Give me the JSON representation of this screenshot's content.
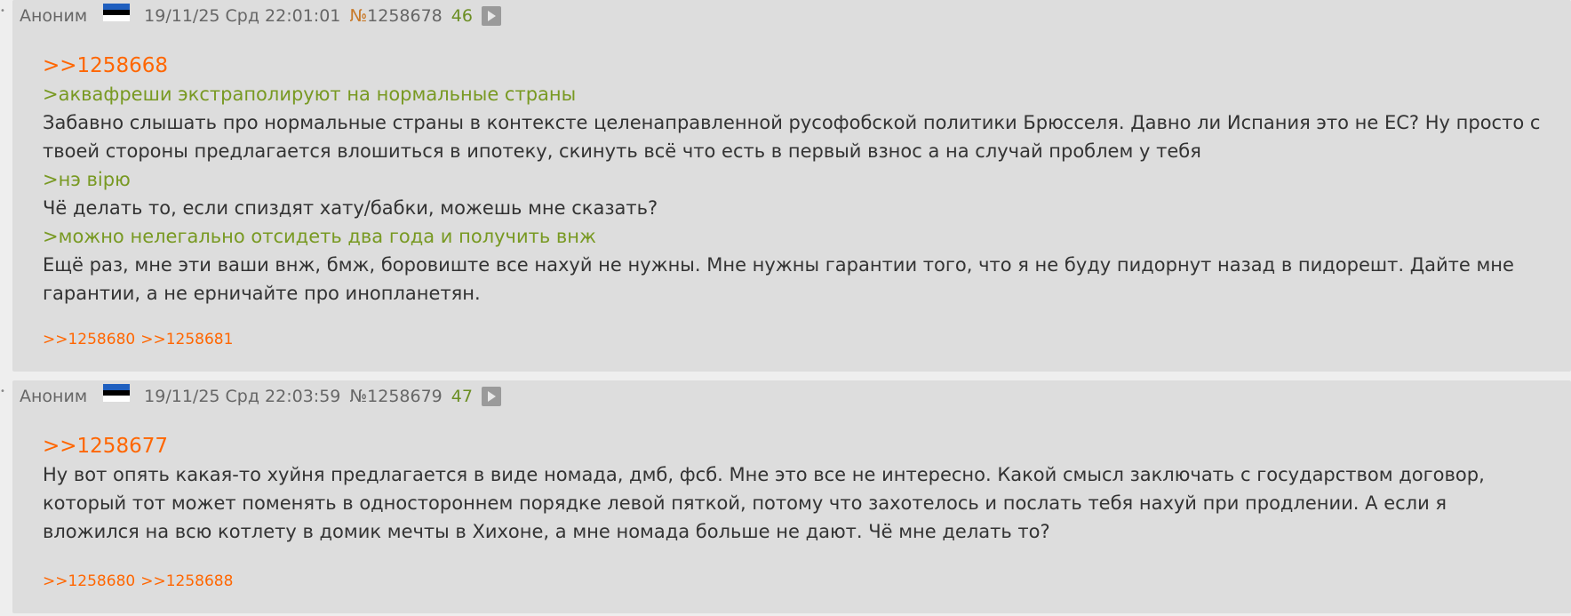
{
  "colors": {
    "page_bg": "#eeeeee",
    "post_bg": "#dddddd",
    "link": "#ff6600",
    "greentext": "#789922",
    "reply_count": "#6b8e23"
  },
  "posts": [
    {
      "marker": "•",
      "author": "Аноним",
      "flag_icon": "estonia-flag-icon",
      "date": "19/11/25 Срд 22:01:01",
      "num_sign": "№",
      "num": "1258678",
      "reply_count": "46",
      "body": {
        "reply_to": ">>1258668",
        "lines": [
          {
            "type": "quote",
            "text": ">аквафреши экстраполируют на нормальные страны"
          },
          {
            "type": "text",
            "text": "Забавно слышать про нормальные страны в контексте целенаправленной русофобской политики Брюсселя. Давно ли Испания это не ЕС? Ну просто с твоей стороны предлагается вл­ошиться в ипотеку, скинуть всё что есть в первый взнос а на случай проблем у тебя"
          },
          {
            "type": "quote",
            "text": ">нэ вiрю"
          },
          {
            "type": "text",
            "text": "Чё делать то, если спиздят хату/бабки, можешь мне сказать?"
          },
          {
            "type": "quote",
            "text": ">можно нелегально отсидеть два года и получить внж"
          },
          {
            "type": "text",
            "text": "Ещё раз, мне эти ваши внж, бмж, боровиште все нахуй не нужны. Мне нужны гарантии того, что я не буду пидорнут назад в пидорешт. Дайте мне гарантии, а не ерничайте про инопланетян."
          }
        ]
      },
      "backlinks": [
        ">>1258680",
        ">>1258681"
      ]
    },
    {
      "marker": "•",
      "author": "Аноним",
      "flag_icon": "estonia-flag-icon",
      "date": "19/11/25 Срд 22:03:59",
      "num_sign": "№",
      "num": "1258679",
      "reply_count": "47",
      "body": {
        "reply_to": ">>1258677",
        "lines": [
          {
            "type": "text",
            "text": "Ну вот опять какая-то хуйня предлагается в виде номада, дмб, фсб. Мне это все не интересно. Какой смысл заключать с государством договор, который тот может поменять в одностороннем порядке левой пяткой, потому что захотелось и послать тебя нахуй при продлении. А если я вложился на всю котлету в домик мечты в Хихоне, а мне номада больше не дают. Чё мне делать то?"
          }
        ]
      },
      "backlinks": [
        ">>1258680",
        ">>1258688"
      ]
    }
  ]
}
